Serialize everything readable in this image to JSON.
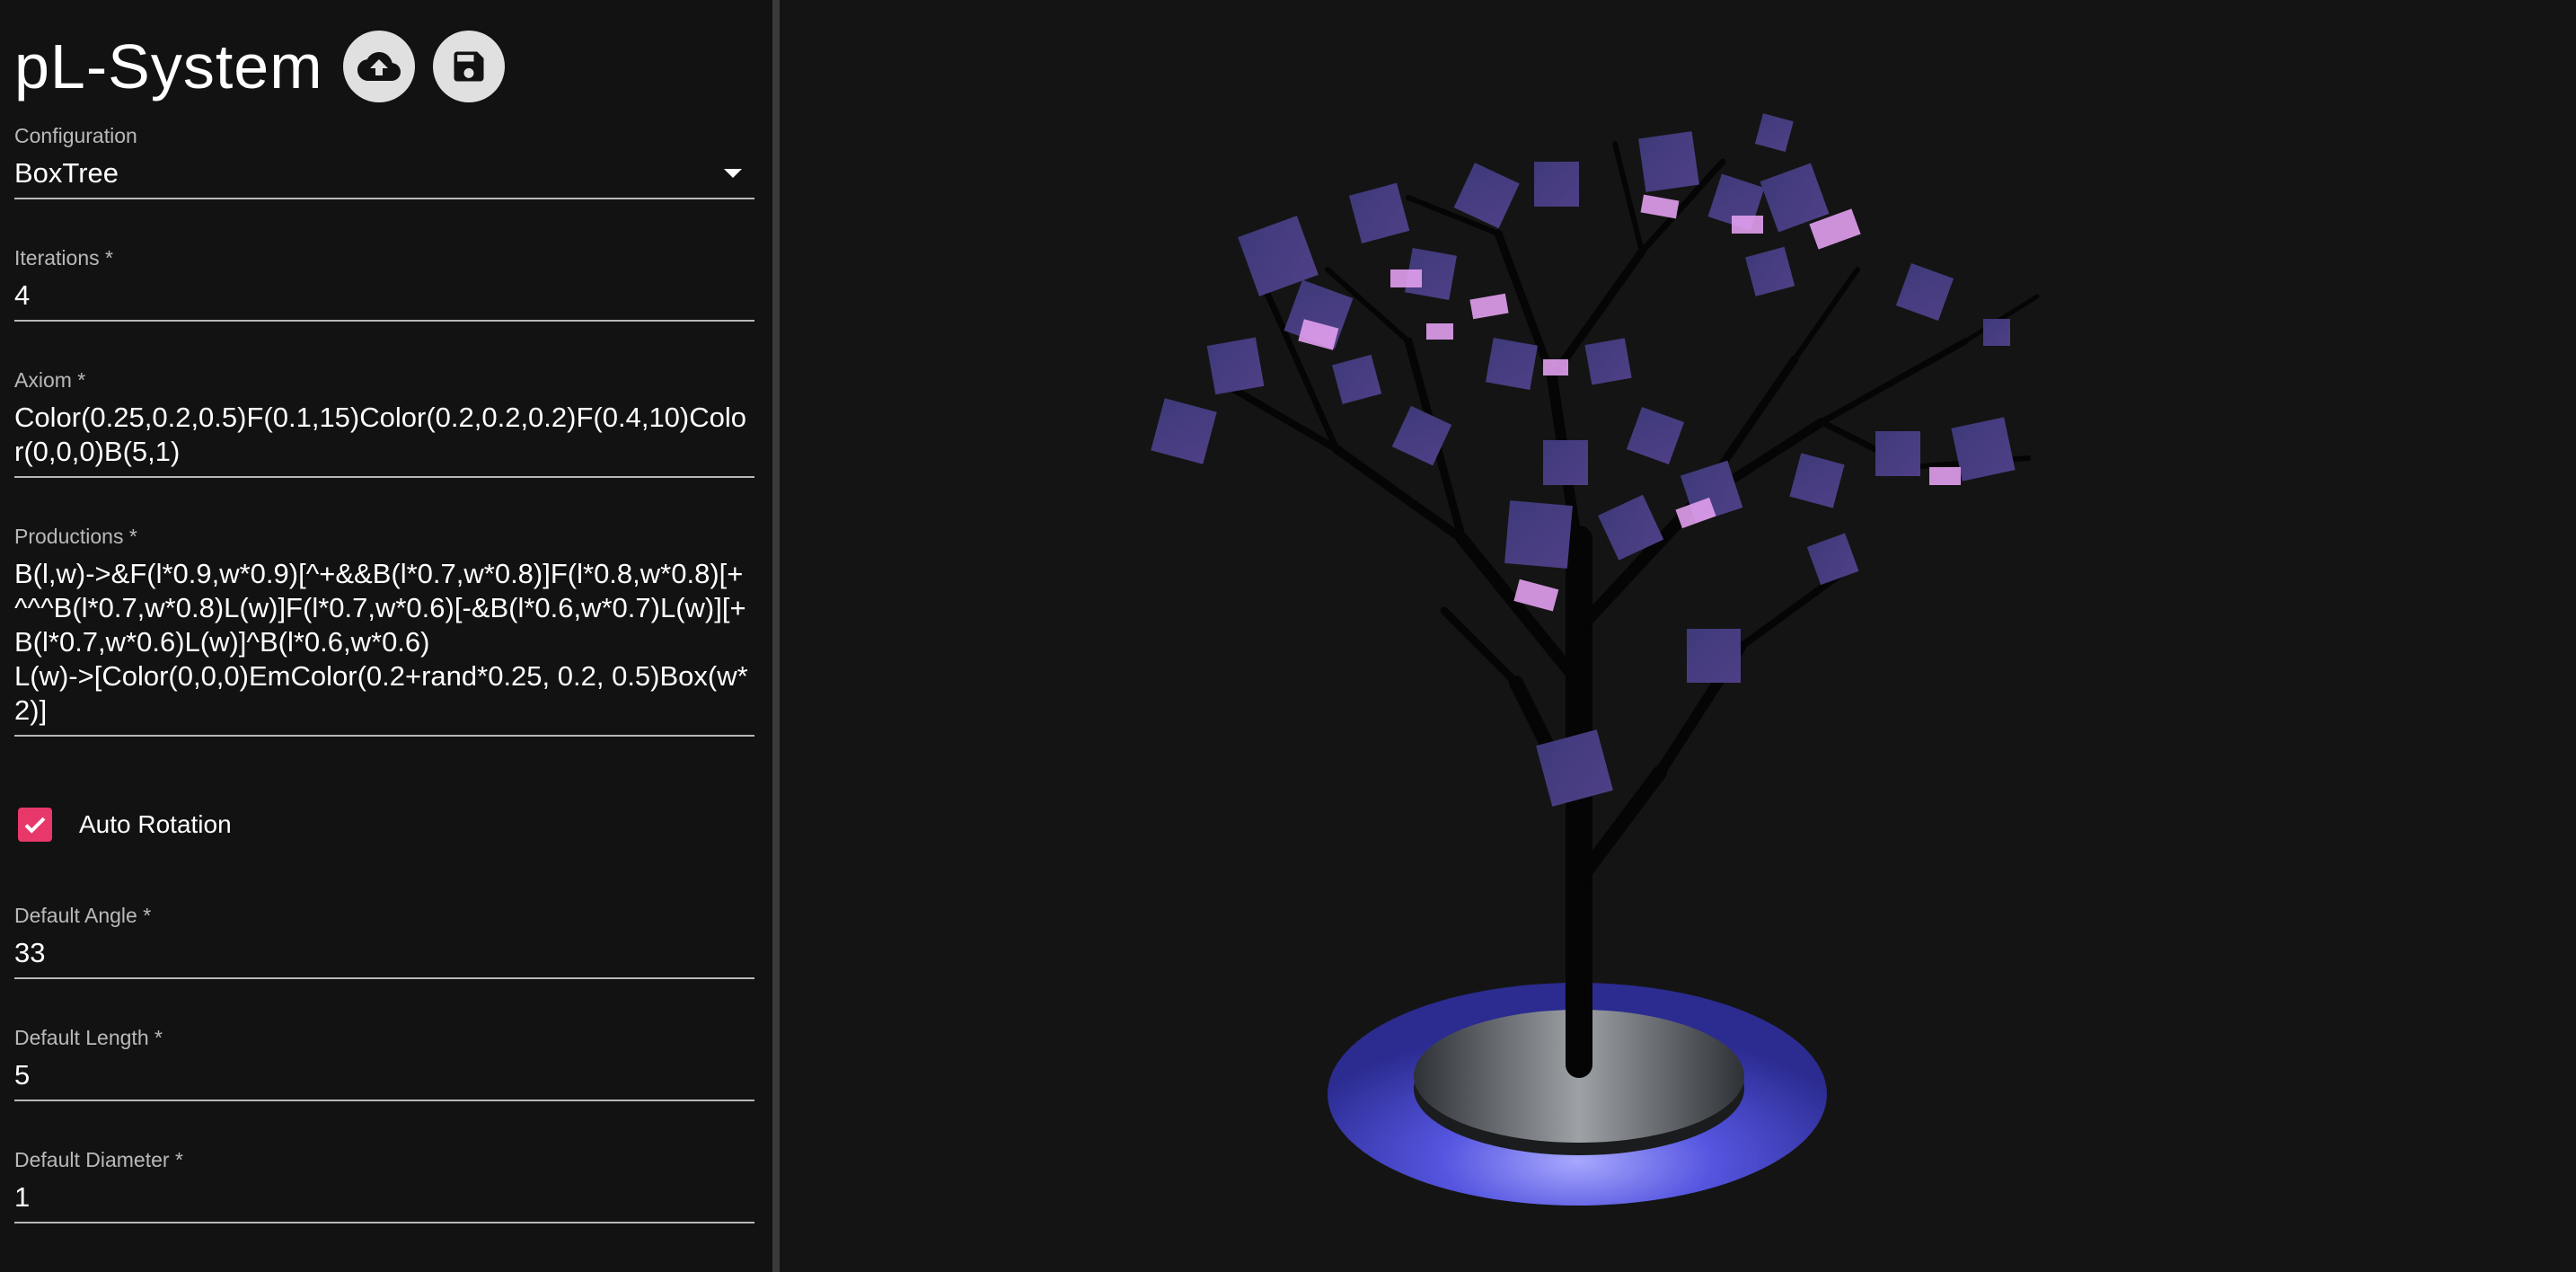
{
  "app": {
    "title": "pL-System",
    "icons": {
      "upload": "cloud-upload-icon",
      "save": "save-icon"
    }
  },
  "fields": {
    "configuration": {
      "label": "Configuration",
      "value": "BoxTree"
    },
    "iterations": {
      "label": "Iterations *",
      "value": "4"
    },
    "axiom": {
      "label": "Axiom *",
      "value": "Color(0.25,0.2,0.5)F(0.1,15)Color(0.2,0.2,0.2)F(0.4,10)Color(0,0,0)B(5,1)"
    },
    "productions": {
      "label": "Productions *",
      "value": "B(l,w)->&F(l*0.9,w*0.9)[^+&&B(l*0.7,w*0.8)]F(l*0.8,w*0.8)[+^^^B(l*0.7,w*0.8)L(w)]F(l*0.7,w*0.6)[-&B(l*0.6,w*0.7)L(w)][+B(l*0.7,w*0.6)L(w)]^B(l*0.6,w*0.6)\nL(w)->[Color(0,0,0)EmColor(0.2+rand*0.25, 0.2, 0.5)Box(w*2)]"
    },
    "auto_rotation": {
      "label": "Auto Rotation",
      "checked": true
    },
    "default_angle": {
      "label": "Default Angle *",
      "value": "33"
    },
    "default_length": {
      "label": "Default Length *",
      "value": "5"
    },
    "default_diameter": {
      "label": "Default Diameter *",
      "value": "1"
    }
  },
  "colors": {
    "background": "#121212",
    "accent_checkbox": "#e8386a",
    "leaf_purple": "#4a3a80",
    "leaf_pink": "#e69cf0",
    "ring_blue": "#5c5ce6"
  }
}
